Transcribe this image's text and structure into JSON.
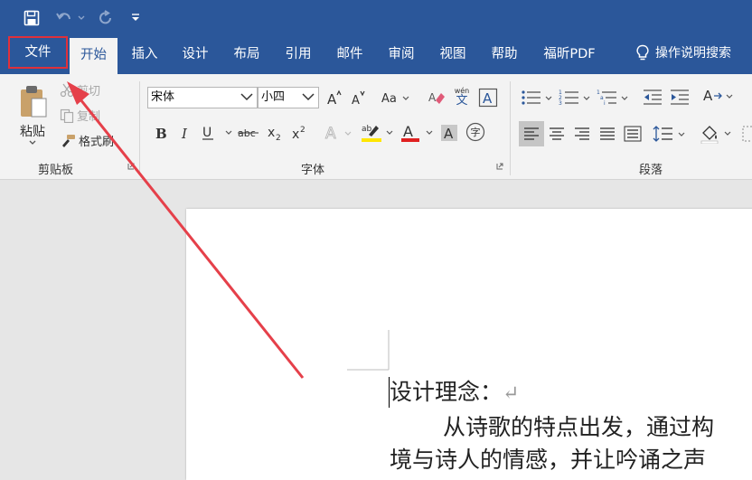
{
  "tabs": {
    "file": "文件",
    "home": "开始",
    "insert": "插入",
    "design": "设计",
    "layout": "布局",
    "references": "引用",
    "mailings": "邮件",
    "review": "审阅",
    "view": "视图",
    "help": "帮助",
    "foxit_pdf": "福昕PDF",
    "tell_me": "操作说明搜索"
  },
  "clipboard": {
    "paste": "粘贴",
    "cut": "剪切",
    "copy": "复制",
    "format_painter": "格式刷",
    "group_label": "剪贴板"
  },
  "font": {
    "font_name": "宋体",
    "font_size": "小四",
    "group_label": "字体",
    "phonetic_top": "wén",
    "phonetic_bottom": "文",
    "enclose_char": "字"
  },
  "paragraph": {
    "group_label": "段落"
  },
  "document": {
    "line1": "设计理念：",
    "line2": "从诗歌的特点出发，通过构",
    "line3": "境与诗人的情感，并让吟诵之声"
  },
  "colors": {
    "accent": "#2b579a",
    "highlight_marker": "#e0303a",
    "font_color": "#e02020",
    "highlight_color": "#ffe600"
  }
}
